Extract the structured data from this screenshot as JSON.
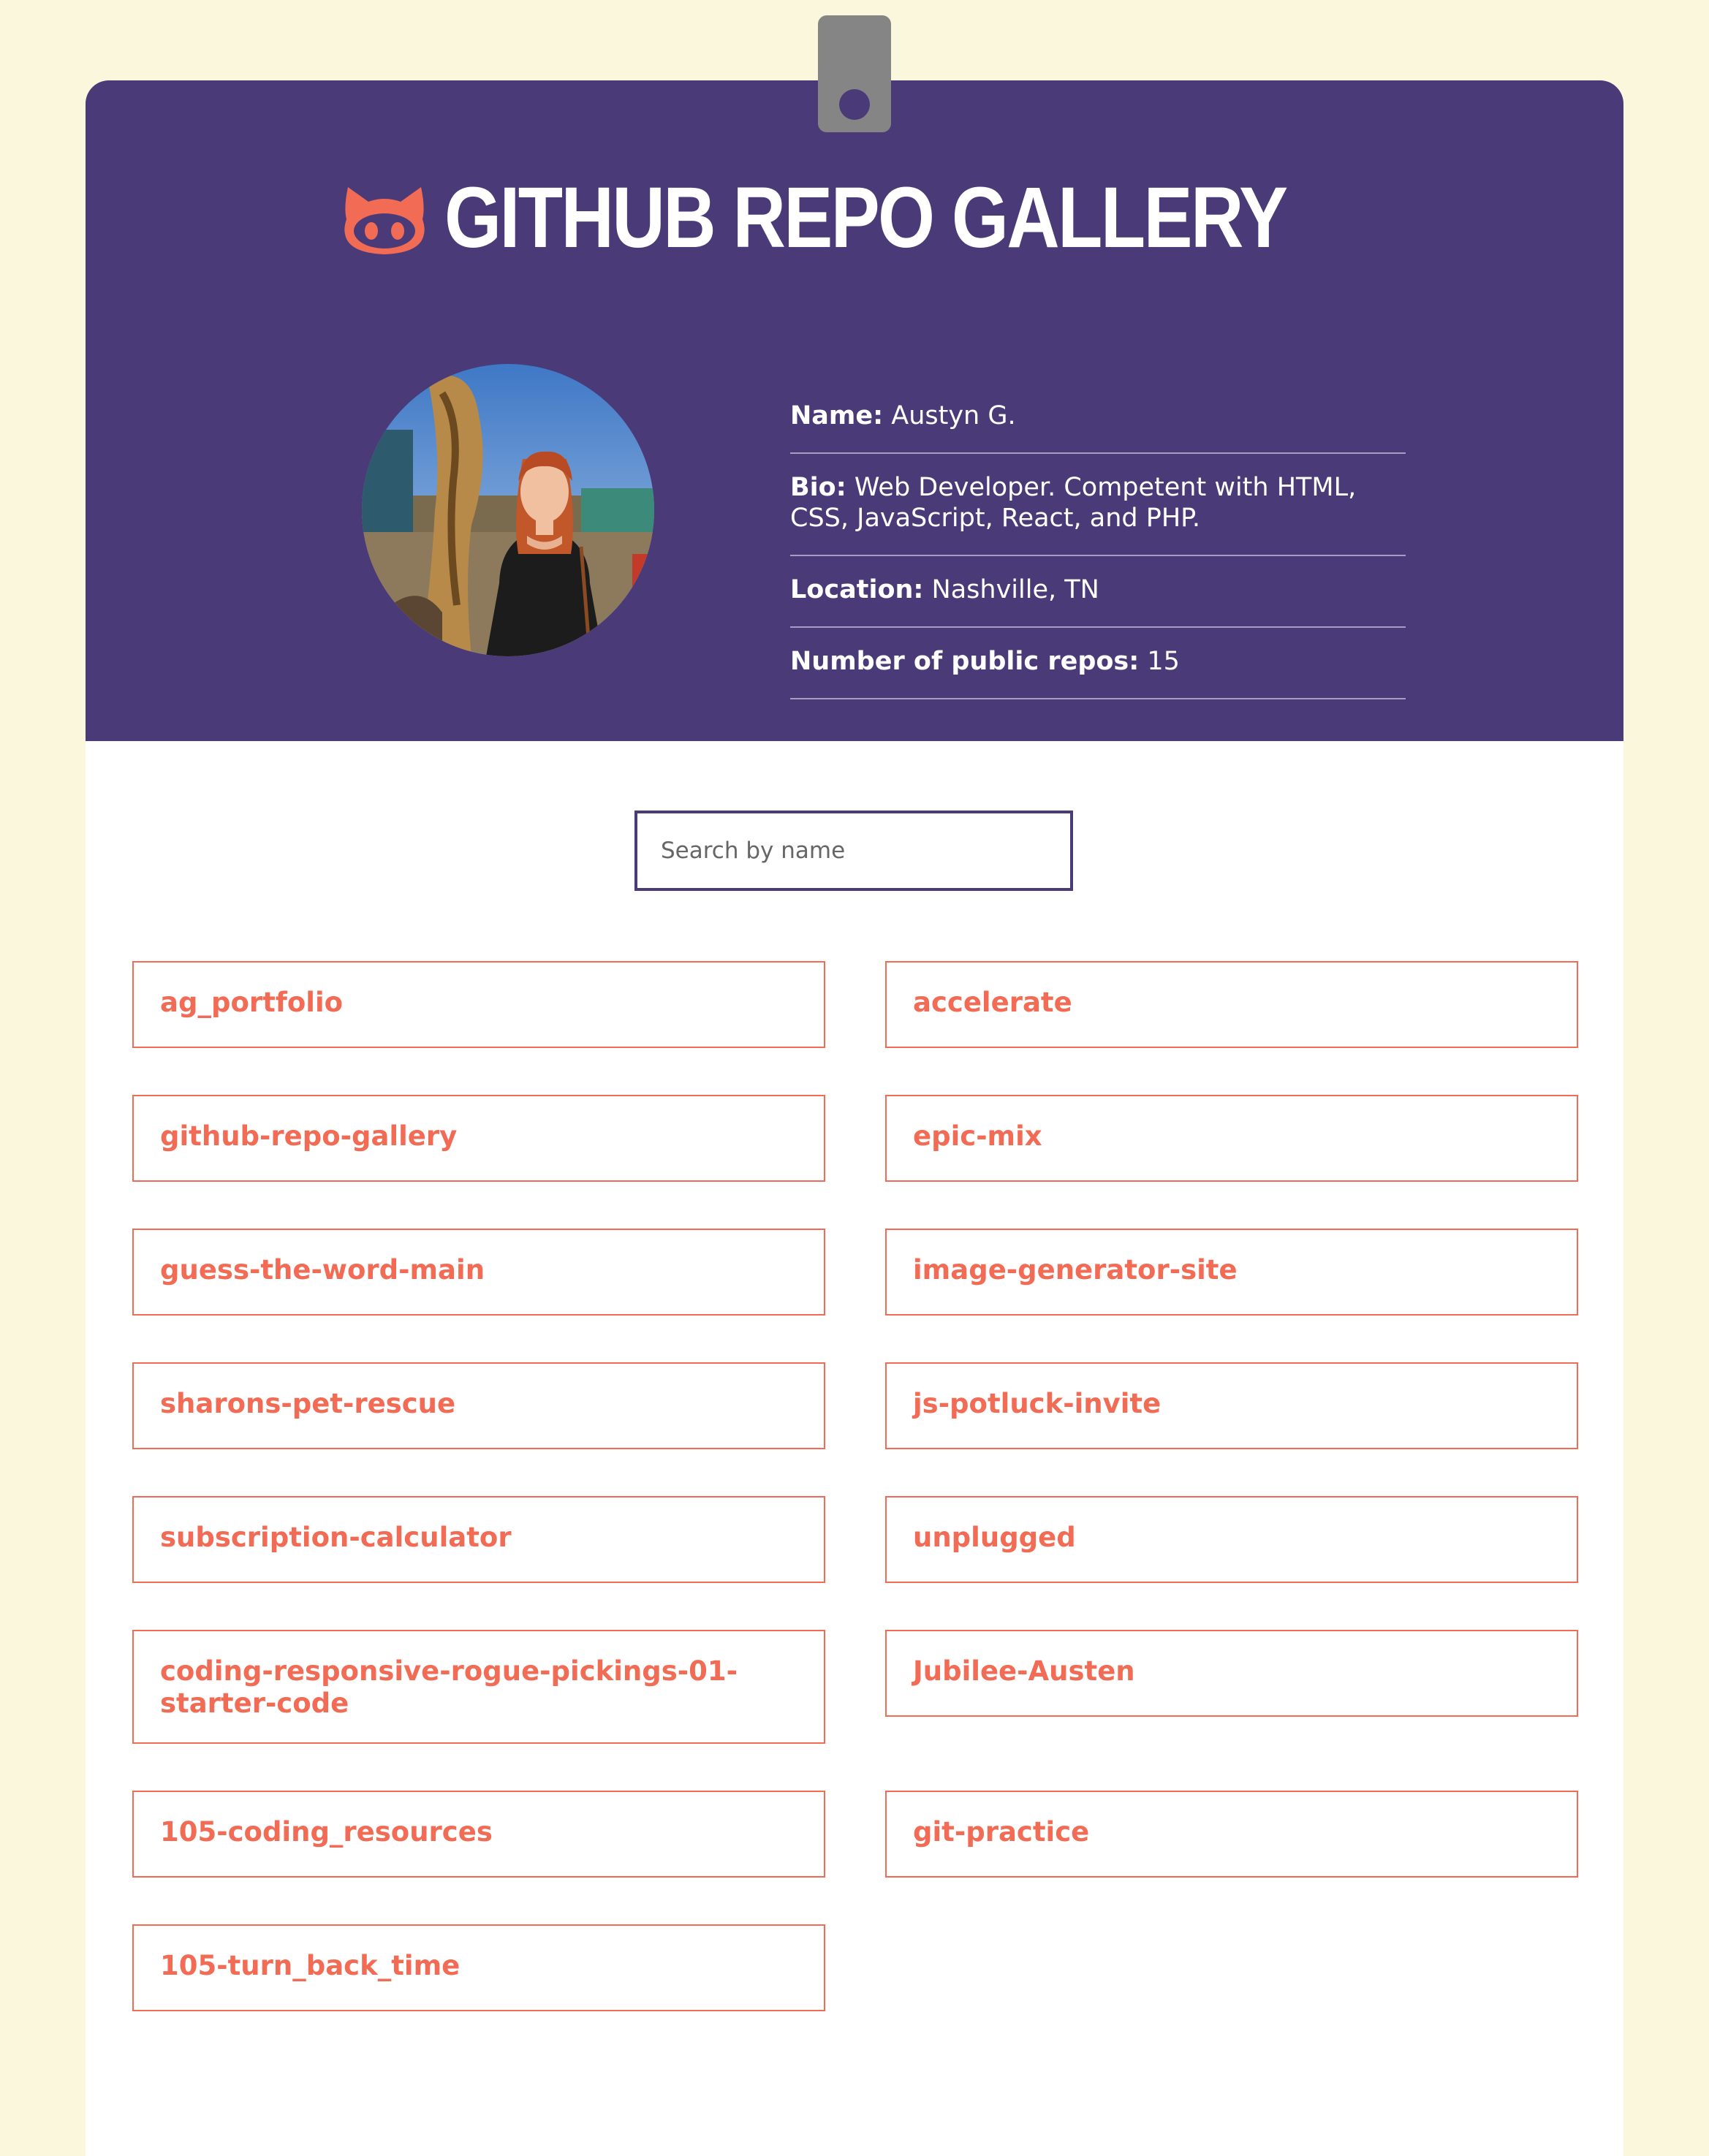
{
  "header": {
    "title": "GITHUB REPO GALLERY",
    "logo_icon": "octocat-icon",
    "clip_icon": "clipboard-clip-icon"
  },
  "profile": {
    "avatar_alt": "User avatar photo",
    "name_label": "Name:",
    "name": "Austyn G.",
    "bio_label": "Bio:",
    "bio": "Web Developer. Competent with HTML, CSS, JavaScript, React, and PHP.",
    "location_label": "Location:",
    "location": "Nashville, TN",
    "repos_label": "Number of public repos:",
    "repos": "15"
  },
  "search": {
    "placeholder": "Search by name"
  },
  "repos": [
    "ag_portfolio",
    "accelerate",
    "github-repo-gallery",
    "epic-mix",
    "guess-the-word-main",
    "image-generator-site",
    "sharons-pet-rescue",
    "js-potluck-invite",
    "subscription-calculator",
    "unplugged",
    "coding-responsive-rogue-pickings-01-starter-code",
    "Jubilee-Austen",
    "105-coding_resources",
    "git-practice",
    "105-turn_back_time"
  ],
  "colors": {
    "background": "#faf7dc",
    "header": "#4a3a78",
    "accent": "#f26b55",
    "clip": "#858585"
  }
}
